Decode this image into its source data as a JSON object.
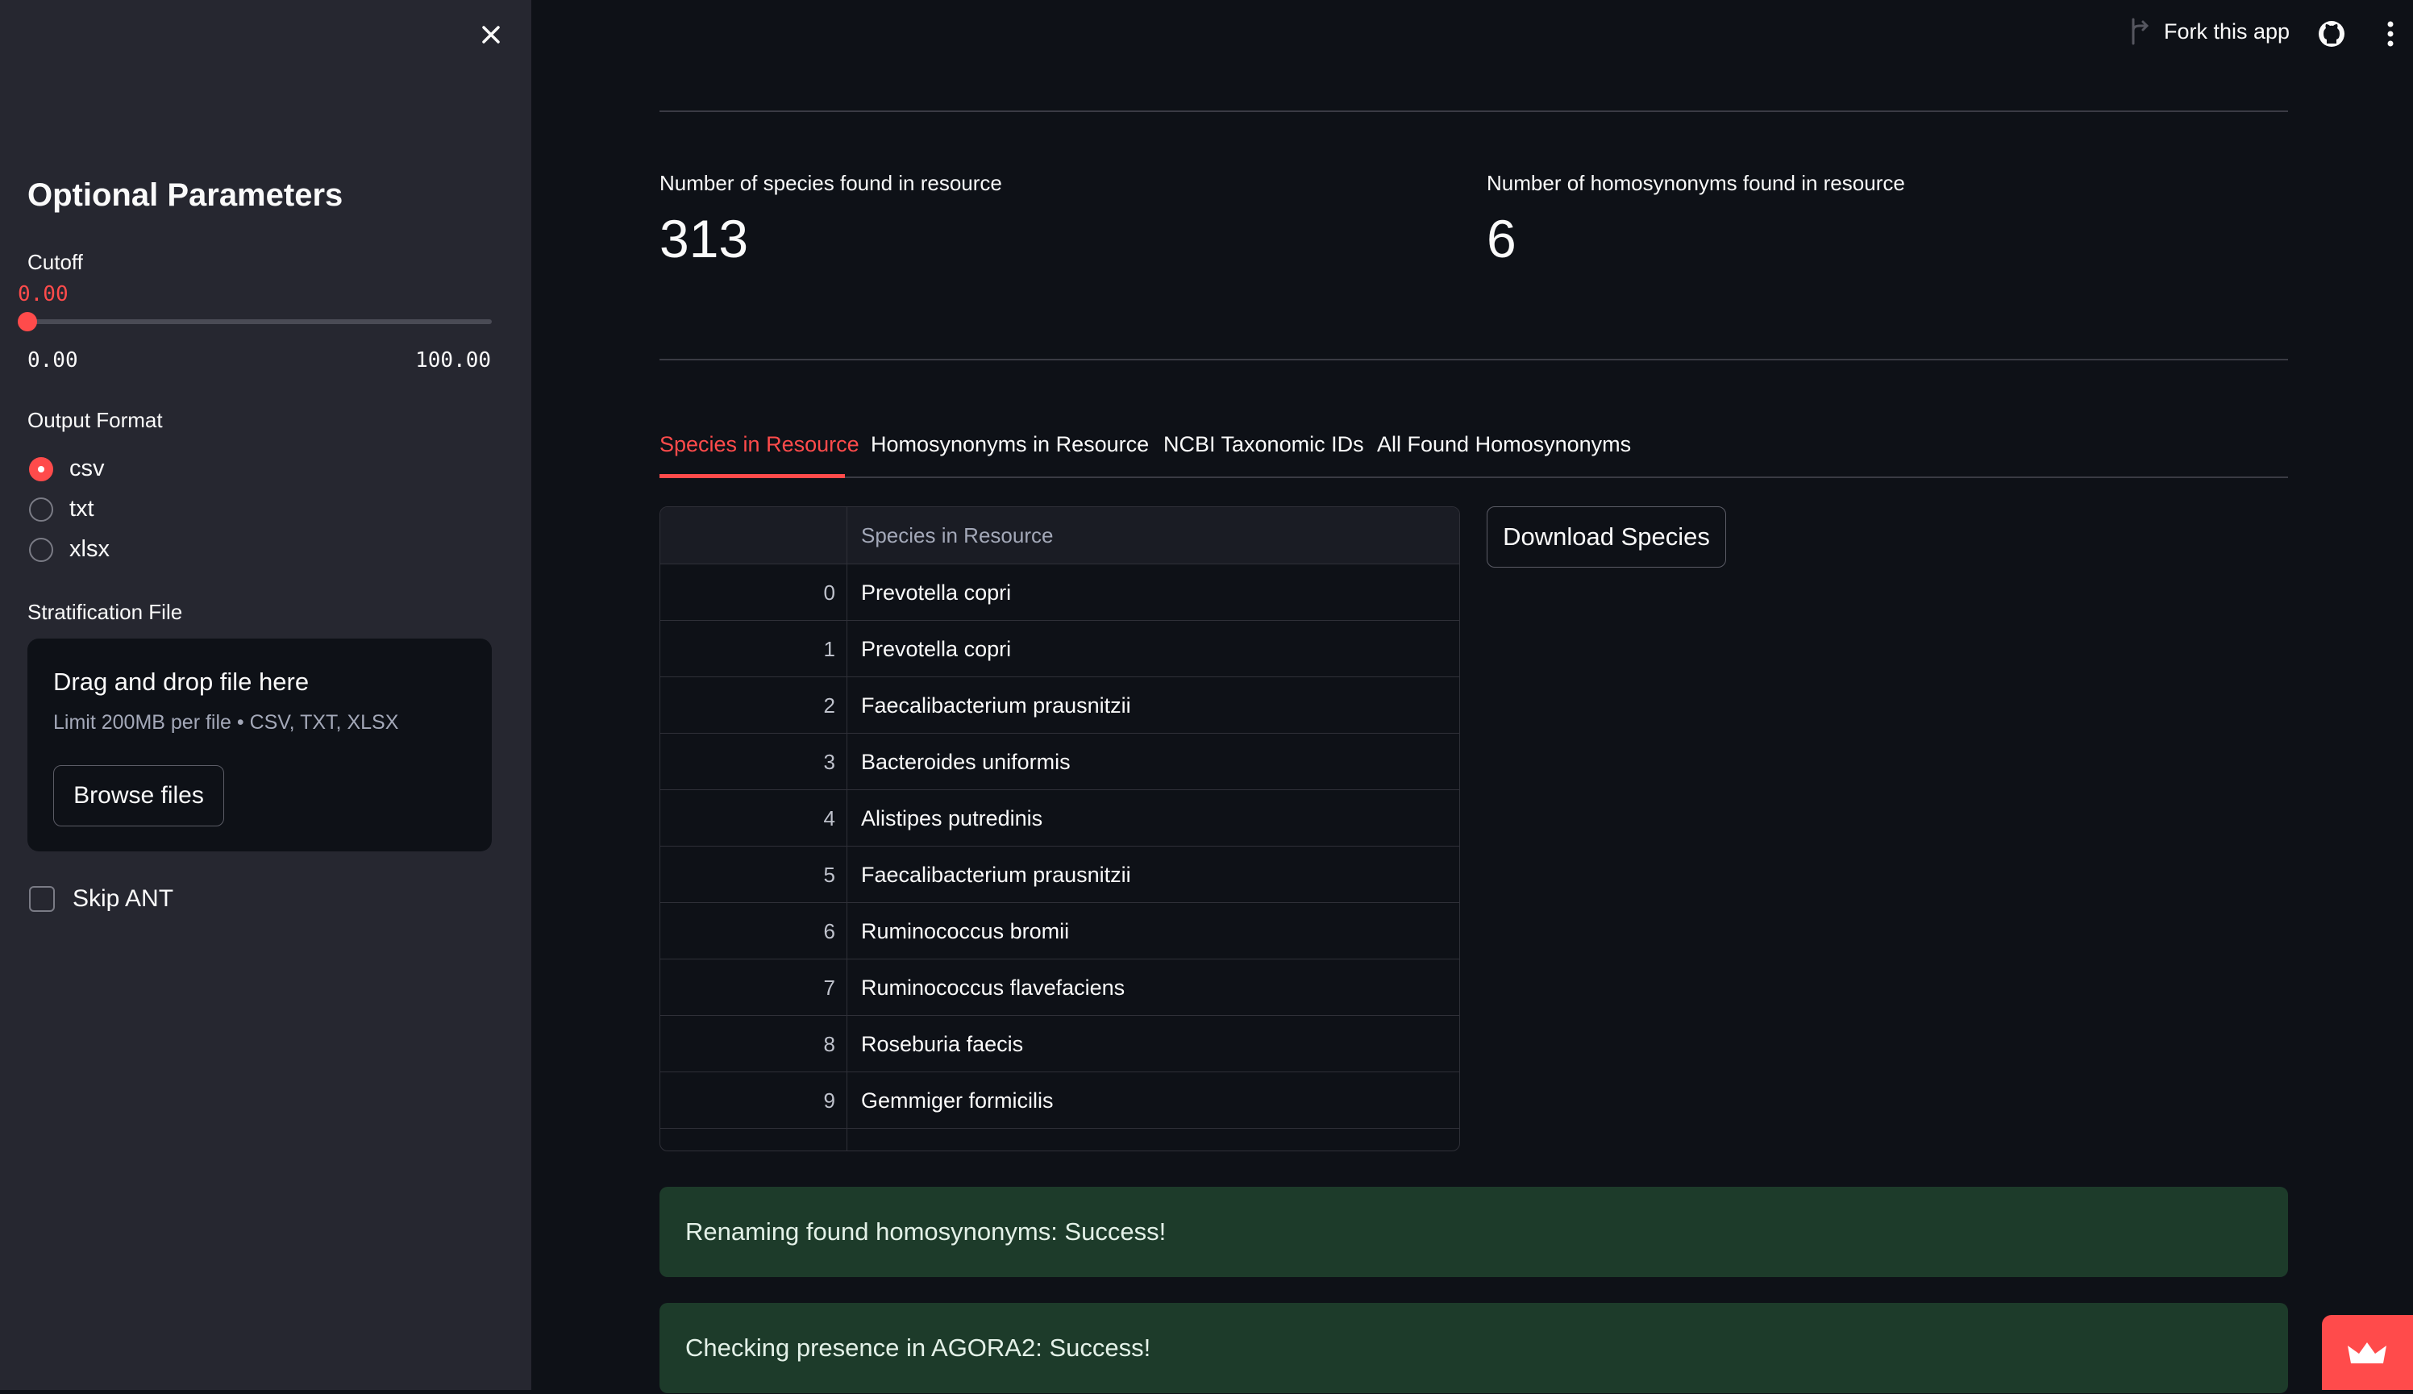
{
  "sidebar": {
    "title": "Optional Parameters",
    "cutoff": {
      "label": "Cutoff",
      "value": "0.00",
      "min": "0.00",
      "max": "100.00",
      "fraction": 0
    },
    "output_format": {
      "label": "Output Format",
      "options": [
        {
          "label": "csv",
          "selected": true
        },
        {
          "label": "txt",
          "selected": false
        },
        {
          "label": "xlsx",
          "selected": false
        }
      ]
    },
    "stratification": {
      "label": "Stratification File",
      "drop_title": "Drag and drop file here",
      "limit": "Limit 200MB per file • CSV, TXT, XLSX",
      "browse_label": "Browse files"
    },
    "skip_ant": {
      "label": "Skip ANT",
      "checked": false
    }
  },
  "header": {
    "fork_label": "Fork this app",
    "icons": [
      "fork-icon",
      "github-icon",
      "more-vert-icon",
      "close-icon"
    ]
  },
  "metrics": [
    {
      "label": "Number of species found in resource",
      "value": "313"
    },
    {
      "label": "Number of homosynonyms found in resource",
      "value": "6"
    }
  ],
  "tabs": [
    {
      "label": "Species in Resource",
      "active": true
    },
    {
      "label": "Homosynonyms in Resource",
      "active": false
    },
    {
      "label": "NCBI Taxonomic IDs",
      "active": false
    },
    {
      "label": "All Found Homosynonyms",
      "active": false
    }
  ],
  "table": {
    "column_header": "Species in Resource",
    "rows": [
      {
        "index": "0",
        "value": "Prevotella copri"
      },
      {
        "index": "1",
        "value": "Prevotella copri"
      },
      {
        "index": "2",
        "value": "Faecalibacterium prausnitzii"
      },
      {
        "index": "3",
        "value": "Bacteroides uniformis"
      },
      {
        "index": "4",
        "value": "Alistipes putredinis"
      },
      {
        "index": "5",
        "value": "Faecalibacterium prausnitzii"
      },
      {
        "index": "6",
        "value": "Ruminococcus bromii"
      },
      {
        "index": "7",
        "value": "Ruminococcus flavefaciens"
      },
      {
        "index": "8",
        "value": "Roseburia faecis"
      },
      {
        "index": "9",
        "value": "Gemmiger formicilis"
      }
    ]
  },
  "download_label": "Download Species",
  "alerts": [
    "Renaming found homosynonyms: Success!",
    "Checking presence in AGORA2: Success!"
  ],
  "colors": {
    "accent": "#ff4b4b",
    "background": "#0e1117",
    "sidebar": "#262730",
    "success_bg": "#1d3b2a"
  }
}
